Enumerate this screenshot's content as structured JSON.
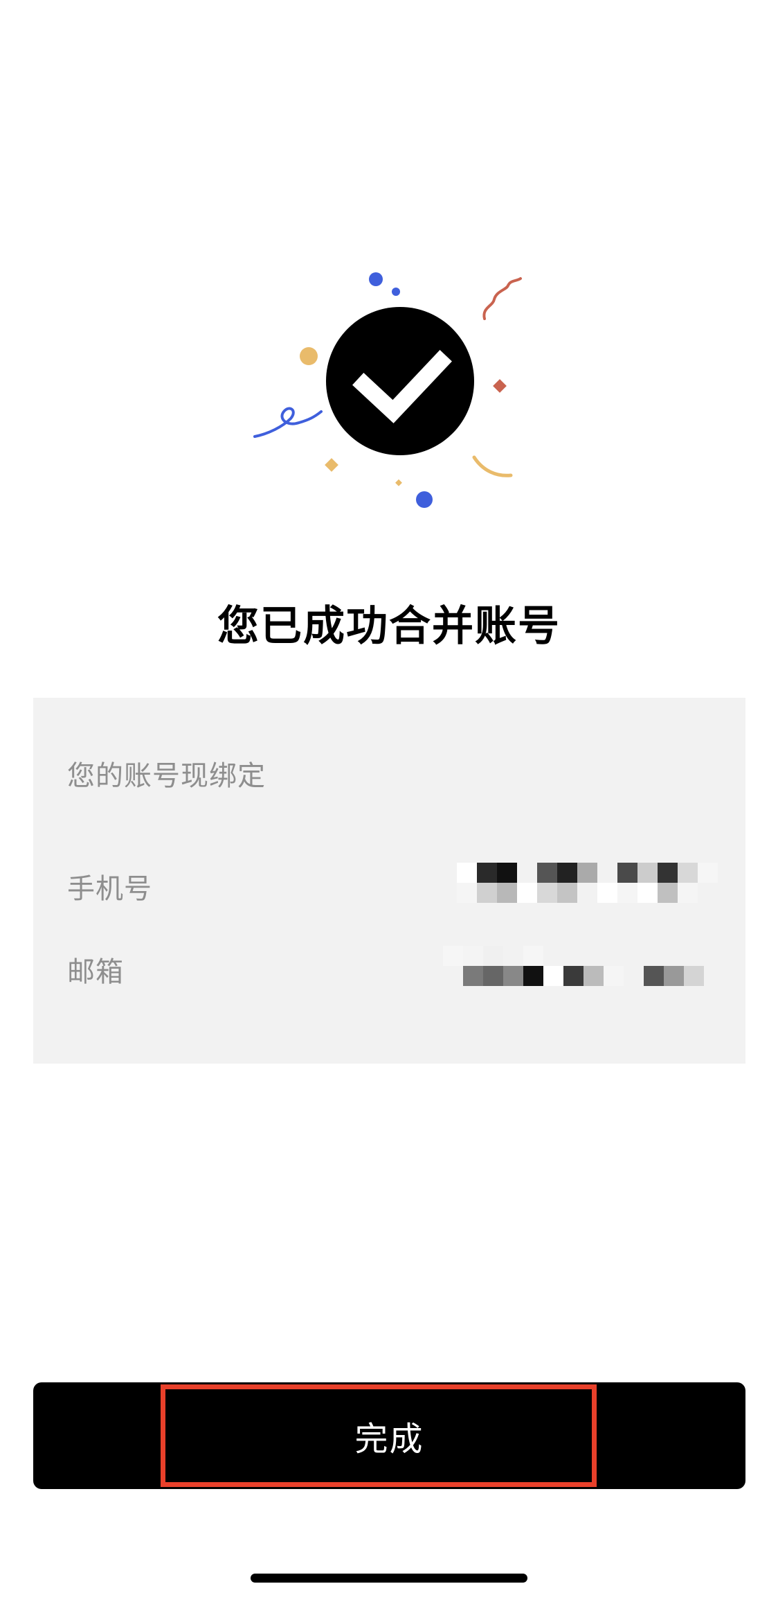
{
  "title": "您已成功合并账号",
  "card": {
    "heading": "您的账号现绑定",
    "phone_label": "手机号",
    "email_label": "邮箱"
  },
  "done_button": {
    "label": "完成"
  },
  "icons": {
    "success": "checkmark-circle-icon",
    "confetti": "confetti-decoration"
  },
  "colors": {
    "primary": "#000000",
    "card_background": "#f2f2f2",
    "secondary_text": "#8e8e8e",
    "highlight": "#e8402a",
    "confetti_blue": "#3f5fdc",
    "confetti_gold": "#e9bb6b",
    "confetti_red": "#c9634f"
  }
}
